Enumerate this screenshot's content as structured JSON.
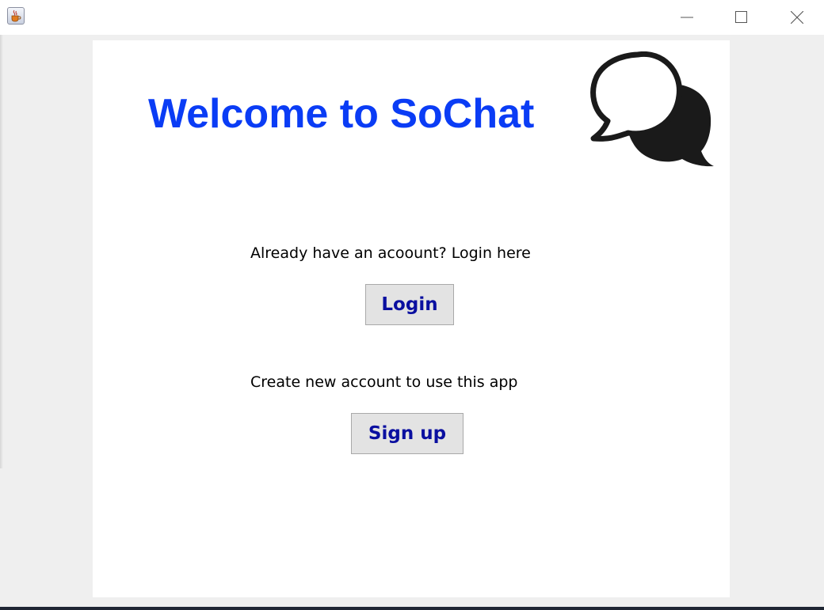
{
  "window": {
    "icon": "java-cup-icon",
    "controls": {
      "minimize": "minimize-icon",
      "maximize": "maximize-icon",
      "close": "close-icon"
    }
  },
  "header": {
    "title": "Welcome to SoChat",
    "logo": "chat-bubbles-icon",
    "title_color": "#0a3cf5"
  },
  "login": {
    "prompt": "Already have an acoount? Login here",
    "button_label": "Login"
  },
  "signup": {
    "prompt": "Create new account to use this app",
    "button_label": "Sign up"
  },
  "colors": {
    "button_text": "#0a0fa0",
    "button_bg": "#e3e3e3",
    "window_bg": "#efefef"
  }
}
